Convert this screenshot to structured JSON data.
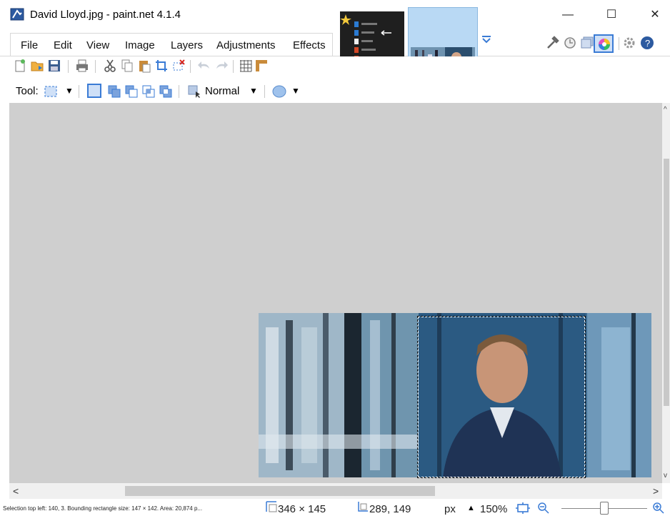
{
  "window": {
    "title": "David Lloyd.jpg - paint.net 4.1.4",
    "controls": {
      "minimize": "—",
      "maximize": "☐",
      "close": "✕"
    }
  },
  "menu": {
    "items": [
      "File",
      "Edit",
      "View",
      "Image",
      "Layers",
      "Adjustments",
      "Effects"
    ]
  },
  "toolbar": {
    "tool_label": "Tool:",
    "blend_mode": "Normal"
  },
  "status": {
    "selection_info": "Selection top left: 140, 3. Bounding rectangle size: 147 × 142. Area: 20,874 p...",
    "image_size": "346 × 145",
    "cursor_pos": "289, 149",
    "units": "px",
    "zoom": "150%"
  },
  "colors": {
    "accent": "#3a7bd5",
    "canvas_bg": "#cfcfcf"
  }
}
